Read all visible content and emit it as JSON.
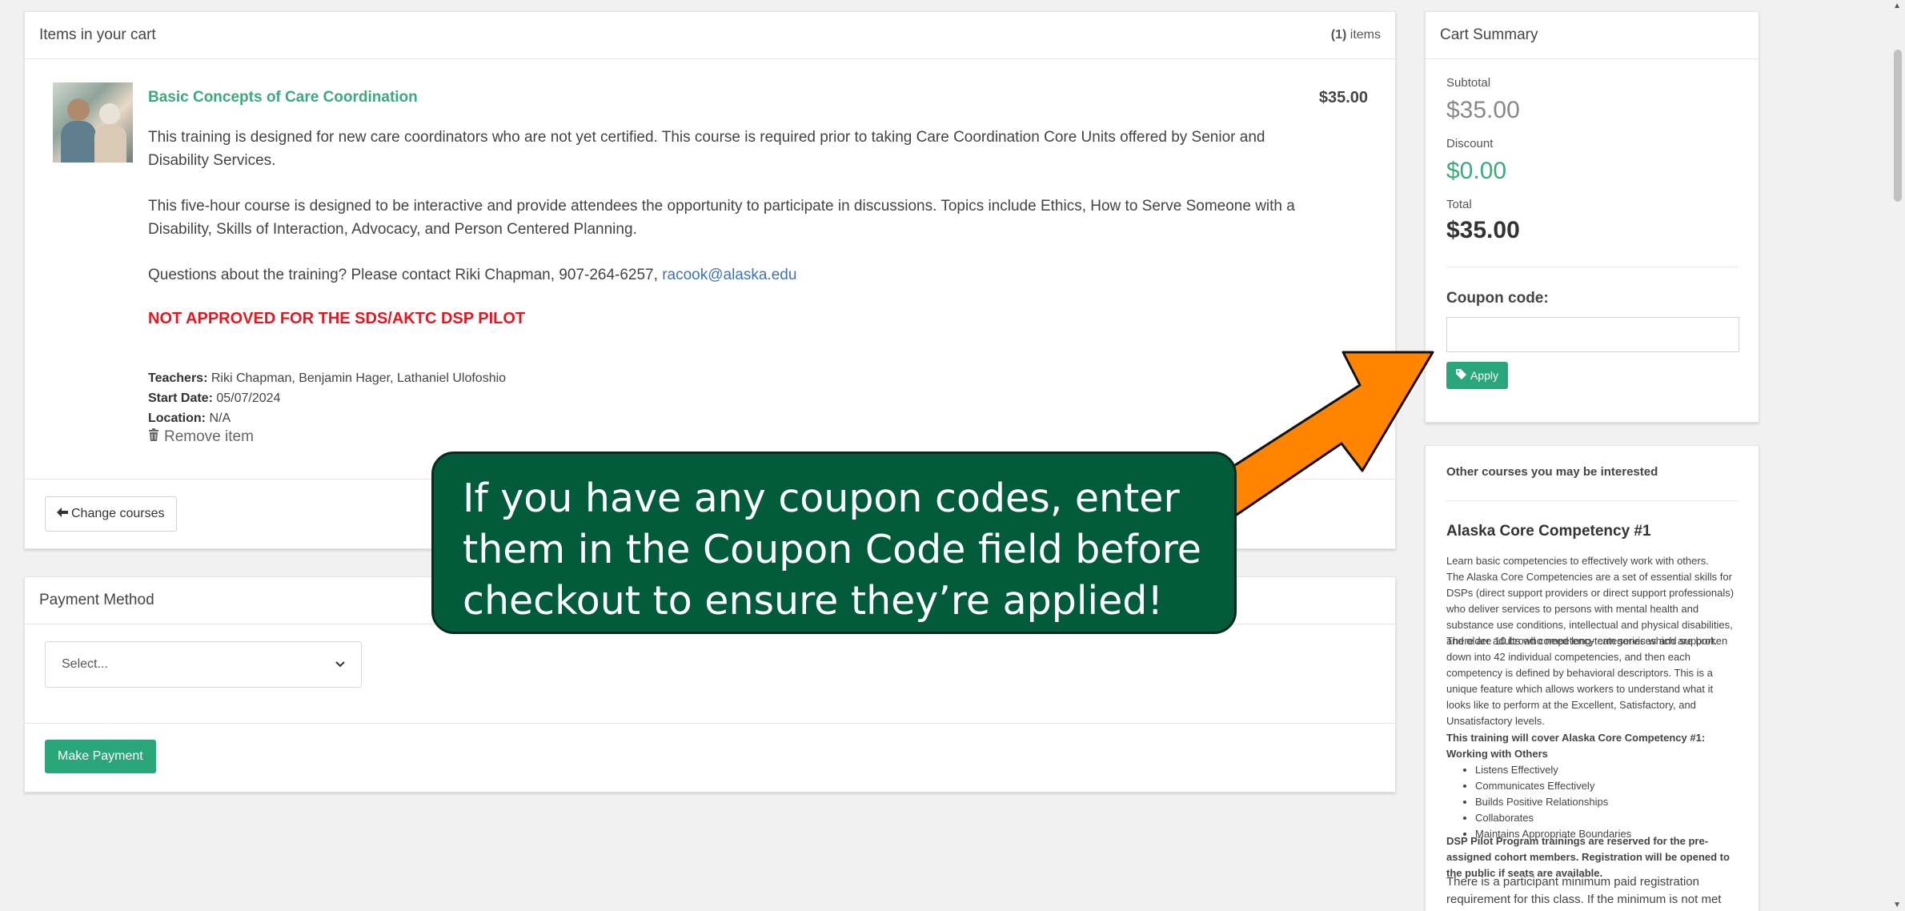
{
  "cart": {
    "header": "Items in your cart",
    "count_num": "(1)",
    "count_suffix": " items",
    "item": {
      "title": "Basic Concepts of Care Coordination",
      "price": "$35.00",
      "desc1": "This training is designed for new care coordinators who are not yet certified. This course is required prior to taking Care Coordination Core Units offered by Senior and Disability Services.",
      "desc2": "This five-hour course is designed to be interactive and provide attendees the opportunity to participate in discussions. Topics include Ethics, How to Serve Someone with a Disability, Skills of Interaction, Advocacy, and Person Centered Planning.",
      "desc3_prefix": "Questions about the training? Please contact Riki Chapman, 907-264-6257, ",
      "desc3_email": "racook@alaska.edu",
      "not_approved": "NOT APPROVED FOR THE SDS/AKTC DSP PILOT",
      "teachers_label": "Teachers:",
      "teachers": " Riki Chapman, Benjamin Hager, Lathaniel Ulofoshio",
      "start_label": "Start Date:",
      "start": " 05/07/2024",
      "location_label": "Location:",
      "location": " N/A",
      "remove": "Remove item"
    },
    "change_courses": "Change courses"
  },
  "payment": {
    "header": "Payment Method",
    "select_value": "Select...",
    "make_payment": "Make Payment"
  },
  "summary": {
    "header": "Cart Summary",
    "subtotal_label": "Subtotal",
    "subtotal": "$35.00",
    "discount_label": "Discount",
    "discount": "$0.00",
    "total_label": "Total",
    "total": "$35.00",
    "coupon_label": "Coupon code:",
    "coupon_value": "",
    "apply": "Apply"
  },
  "other": {
    "header": "Other courses you may be interested",
    "title": "Alaska Core Competency #1",
    "intro": "Learn basic competencies to effectively work with others.",
    "para1": "The Alaska Core Competencies are a set of essential skills for DSPs (direct support providers or direct support professionals) who deliver services to persons with mental health and substance use conditions, intellectual and physical disabilities, and older adults who need long-term services and support.",
    "para2": "There are 10 broad competency categories which are broken down into 42 individual competencies, and then each competency is defined by behavioral descriptors. This is a unique feature which allows workers to understand what it looks like to perform at the Excellent, Satisfactory, and Unsatisfactory levels.",
    "list_heading": "This training will cover Alaska Core Competency #1: Working with Others",
    "list": [
      "Listens Effectively",
      "Communicates Effectively",
      "Builds Positive Relationships",
      "Collaborates",
      "Maintains Appropriate Boundaries"
    ],
    "pilot_note": "DSP Pilot Program trainings are reserved for the pre-assigned cohort members. Registration will be opened to the public if seats are available.",
    "min_note": "There is a participant minimum paid registration requirement for this class. If the minimum is not met the training will be cancelled and participants will be notified."
  },
  "callout": {
    "text": "If you have any coupon codes, enter them in the Coupon Code field before checkout to ensure they’re applied!"
  },
  "colors": {
    "accent": "#2aa67b",
    "callout_bg": "#025c3c",
    "arrow": "#ff8400",
    "warning": "#e8141e"
  }
}
